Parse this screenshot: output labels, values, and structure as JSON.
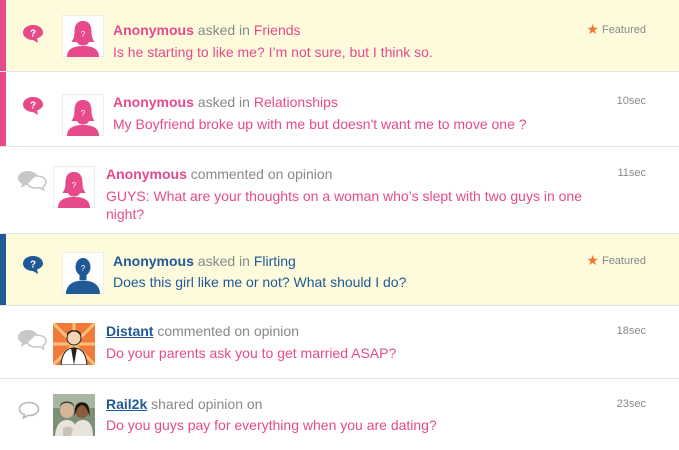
{
  "colors": {
    "pink": "#e64a8b",
    "blue": "#1f5a96",
    "featured_bg": "#fdfbdc",
    "star": "#f4762d",
    "gray_text": "#888888"
  },
  "feed": [
    {
      "user": "Anonymous",
      "verb": "asked in",
      "target": "Friends",
      "title": "Is he starting to like me? I’m not sure, but I think so.",
      "right": "Featured",
      "featured": true,
      "type_icon": "question-bubble-icon",
      "avatar": "female-anonymous-avatar"
    },
    {
      "user": "Anonymous",
      "verb": "asked in",
      "target": "Relationships",
      "title": "My Boyfriend broke up with me but doesn't want me to move one ?",
      "right": "10sec",
      "featured": false,
      "type_icon": "question-bubble-icon",
      "avatar": "female-anonymous-avatar"
    },
    {
      "user": "Anonymous",
      "verb": "commented on opinion",
      "target": "",
      "title": "GUYS: What are your thoughts on a woman who’s slept with two guys in one night?",
      "right": "11sec",
      "featured": false,
      "type_icon": "comment-bubbles-icon",
      "avatar": "female-anonymous-avatar"
    },
    {
      "user": "Anonymous",
      "verb": "asked in",
      "target": "Flirting",
      "title": "Does this girl like me or not? What should I do?",
      "right": "Featured",
      "featured": true,
      "type_icon": "question-bubble-icon",
      "avatar": "male-anonymous-avatar"
    },
    {
      "user": "Distant",
      "verb": "commented on opinion",
      "target": "",
      "title": "Do your parents ask you to get married ASAP?",
      "right": "18sec",
      "featured": false,
      "type_icon": "comment-bubbles-icon",
      "avatar": "user-photo-avatar"
    },
    {
      "user": "Rail2k",
      "verb": "shared opinion on",
      "target": "",
      "title": "Do you guys pay for everything when you are dating?",
      "right": "23sec",
      "featured": false,
      "type_icon": "share-bubble-icon",
      "avatar": "user-photo-avatar"
    }
  ]
}
